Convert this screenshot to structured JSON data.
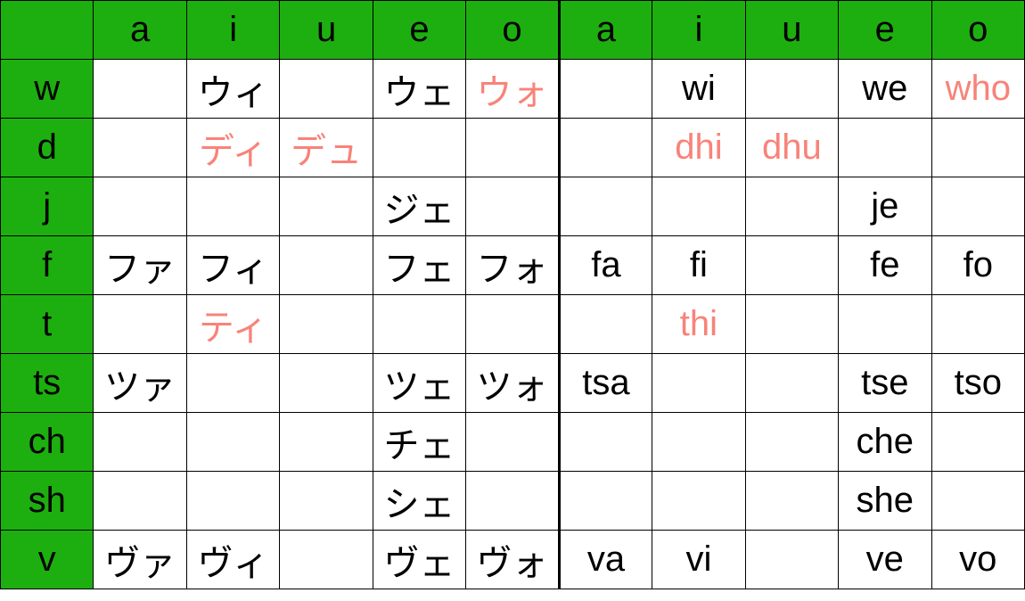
{
  "colors": {
    "header_bg": "#1DAF0F",
    "highlight": "#F88379"
  },
  "vowels": [
    "a",
    "i",
    "u",
    "e",
    "o"
  ],
  "rows": [
    {
      "label": "w",
      "kana": [
        {
          "t": ""
        },
        {
          "t": "ウィ"
        },
        {
          "t": ""
        },
        {
          "t": "ウェ"
        },
        {
          "t": "ウォ",
          "hl": true
        }
      ],
      "romaji": [
        {
          "t": ""
        },
        {
          "t": "wi"
        },
        {
          "t": ""
        },
        {
          "t": "we"
        },
        {
          "t": "who",
          "hl": true
        }
      ]
    },
    {
      "label": "d",
      "kana": [
        {
          "t": ""
        },
        {
          "t": "ディ",
          "hl": true
        },
        {
          "t": "デュ",
          "hl": true
        },
        {
          "t": ""
        },
        {
          "t": ""
        }
      ],
      "romaji": [
        {
          "t": ""
        },
        {
          "t": "dhi",
          "hl": true
        },
        {
          "t": "dhu",
          "hl": true
        },
        {
          "t": ""
        },
        {
          "t": ""
        }
      ]
    },
    {
      "label": "j",
      "kana": [
        {
          "t": ""
        },
        {
          "t": ""
        },
        {
          "t": ""
        },
        {
          "t": "ジェ"
        },
        {
          "t": ""
        }
      ],
      "romaji": [
        {
          "t": ""
        },
        {
          "t": ""
        },
        {
          "t": ""
        },
        {
          "t": "je"
        },
        {
          "t": ""
        }
      ]
    },
    {
      "label": "f",
      "kana": [
        {
          "t": "ファ"
        },
        {
          "t": "フィ"
        },
        {
          "t": ""
        },
        {
          "t": "フェ"
        },
        {
          "t": "フォ"
        }
      ],
      "romaji": [
        {
          "t": "fa"
        },
        {
          "t": "fi"
        },
        {
          "t": ""
        },
        {
          "t": "fe"
        },
        {
          "t": "fo"
        }
      ]
    },
    {
      "label": "t",
      "kana": [
        {
          "t": ""
        },
        {
          "t": "ティ",
          "hl": true
        },
        {
          "t": ""
        },
        {
          "t": ""
        },
        {
          "t": ""
        }
      ],
      "romaji": [
        {
          "t": ""
        },
        {
          "t": "thi",
          "hl": true
        },
        {
          "t": ""
        },
        {
          "t": ""
        },
        {
          "t": ""
        }
      ]
    },
    {
      "label": "ts",
      "kana": [
        {
          "t": "ツァ"
        },
        {
          "t": ""
        },
        {
          "t": ""
        },
        {
          "t": "ツェ"
        },
        {
          "t": "ツォ"
        }
      ],
      "romaji": [
        {
          "t": "tsa"
        },
        {
          "t": ""
        },
        {
          "t": ""
        },
        {
          "t": "tse"
        },
        {
          "t": "tso"
        }
      ]
    },
    {
      "label": "ch",
      "kana": [
        {
          "t": ""
        },
        {
          "t": ""
        },
        {
          "t": ""
        },
        {
          "t": "チェ"
        },
        {
          "t": ""
        }
      ],
      "romaji": [
        {
          "t": ""
        },
        {
          "t": ""
        },
        {
          "t": ""
        },
        {
          "t": "che"
        },
        {
          "t": ""
        }
      ]
    },
    {
      "label": "sh",
      "kana": [
        {
          "t": ""
        },
        {
          "t": ""
        },
        {
          "t": ""
        },
        {
          "t": "シェ"
        },
        {
          "t": ""
        }
      ],
      "romaji": [
        {
          "t": ""
        },
        {
          "t": ""
        },
        {
          "t": ""
        },
        {
          "t": "she"
        },
        {
          "t": ""
        }
      ]
    },
    {
      "label": "v",
      "kana": [
        {
          "t": "ヴァ"
        },
        {
          "t": "ヴィ"
        },
        {
          "t": ""
        },
        {
          "t": "ヴェ"
        },
        {
          "t": "ヴォ"
        }
      ],
      "romaji": [
        {
          "t": "va"
        },
        {
          "t": "vi"
        },
        {
          "t": ""
        },
        {
          "t": "ve"
        },
        {
          "t": "vo"
        }
      ]
    }
  ]
}
